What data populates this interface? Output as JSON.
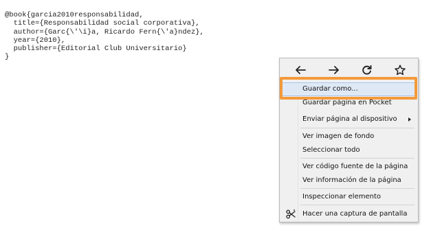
{
  "bibtex": {
    "lines": [
      "@book{garcia2010responsabilidad,",
      "  title={Responsabilidad social corporativa},",
      "  author={Garc{\\'\\i}a, Ricardo Fern{\\'a}ndez},",
      "  year={2010},",
      "  publisher={Editorial Club Universitario}",
      "}"
    ]
  },
  "context_menu": {
    "nav_icons": [
      "back-arrow-icon",
      "forward-arrow-icon",
      "reload-icon",
      "bookmark-star-icon"
    ],
    "items": [
      {
        "label": "Guardar como...",
        "highlighted": true
      },
      {
        "label": "Guardar página en Pocket"
      },
      {
        "label": "Enviar página al dispositivo",
        "has_submenu": true
      },
      {
        "label": "Ver imagen de fondo"
      },
      {
        "label": "Seleccionar todo"
      },
      {
        "label": "Ver código fuente de la página"
      },
      {
        "label": "Ver información de la página"
      },
      {
        "label": "Inspeccionar elemento"
      },
      {
        "label": "Hacer una captura de pantalla",
        "icon": "scissors-icon"
      }
    ]
  },
  "colors": {
    "highlight_frame": "#f39a3a",
    "menu_background": "#f0f0f0",
    "item_highlight": "#dfe9f6"
  }
}
